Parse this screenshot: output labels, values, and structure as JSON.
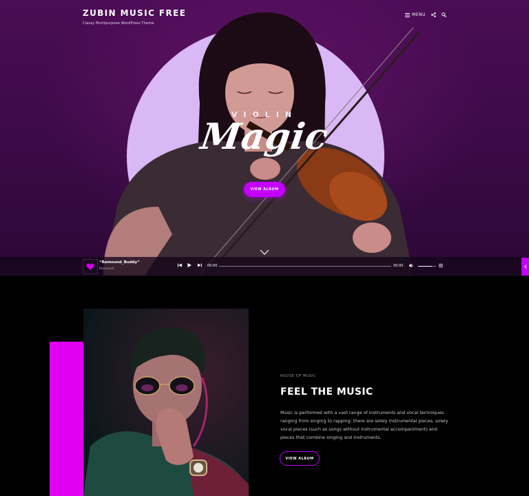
{
  "site": {
    "title": "ZUBIN MUSIC FREE",
    "tagline": "Classy Multipurpose WordPress Theme"
  },
  "nav": {
    "menu_label": "MENU",
    "icons": [
      "hamburger-icon",
      "share-icon",
      "search-icon"
    ]
  },
  "hero": {
    "subtitle": "VIOLIN",
    "title": "Magic",
    "button_label": "VIEW ALBUM",
    "circle_color": "#dab7f5",
    "background_color": "#3b0a46"
  },
  "player": {
    "track_title": "“Remound_Buddy”",
    "artist": "Remound",
    "current_time": "00:00",
    "duration": "00:00",
    "icons": [
      "prev-icon",
      "play-icon",
      "next-icon",
      "volume-icon",
      "playlist-icon"
    ]
  },
  "feature": {
    "eyebrow": "HOUSE OF MUSIC",
    "title": "FEEL THE MUSIC",
    "body": "Music is performed with a vast range of instruments and vocal techniques ranging from singing to rapping; there are solely instrumental pieces, solely vocal pieces (such as songs without instrumental accompaniment) and pieces that combine singing and instruments.",
    "button_label": "VIEW ALBUM",
    "accent_color": "#e200f2"
  },
  "colors": {
    "accent": "#c300ff",
    "page_background": "#000000"
  }
}
